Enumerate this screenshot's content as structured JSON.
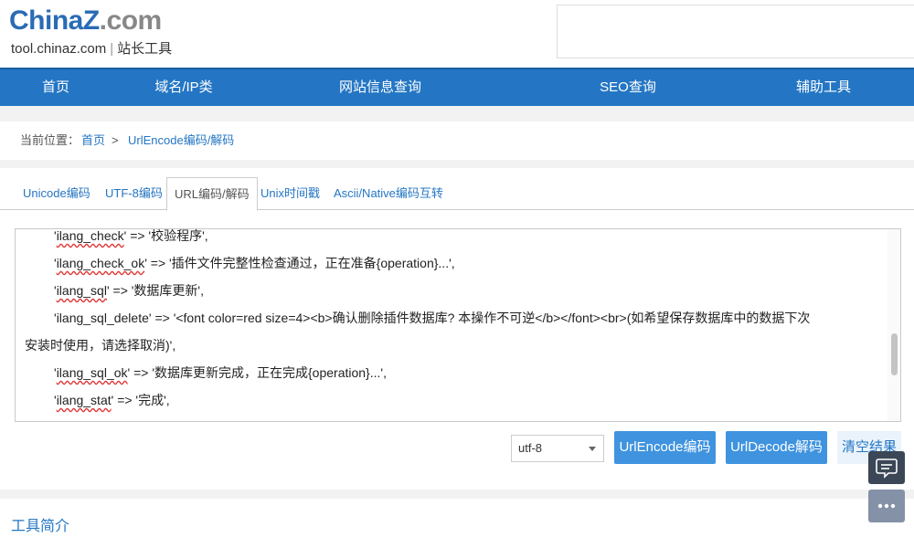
{
  "logo": {
    "brand_a": "China",
    "brand_z": "Z",
    "brand_b": ".com",
    "site": "tool.chinaz.com",
    "sep": "|",
    "tagline": "站长工具"
  },
  "nav": {
    "items": [
      "首页",
      "域名/IP类",
      "网站信息查询",
      "SEO查询",
      "辅助工具"
    ]
  },
  "breadcrumb": {
    "label": "当前位置：",
    "home": "首页",
    "arrow": ">",
    "current": "UrlEncode编码/解码"
  },
  "tabs": [
    "Unicode编码",
    "UTF-8编码",
    "URL编码/解码",
    "Unix时间戳",
    "Ascii/Native编码互转"
  ],
  "editor": {
    "lines": [
      {
        "key": "ilang_check",
        "rest": "' => '校验程序',"
      },
      {
        "key": "ilang_check_ok",
        "rest": "' => '插件文件完整性检查通过，正在准备{operation}...',"
      },
      {
        "key": "ilang_sql",
        "rest": "' => '数据库更新',"
      },
      {
        "key": "ilang_sql_delete",
        "rest": "' => '<font color=red size=4><b>确认删除插件数据库? 本操作不可逆</b></font><br>(如希望保存数据库中的数据下次"
      },
      {
        "key": "",
        "rest": "安装时使用，请选择取消)',"
      },
      {
        "key": "ilang_sql_ok",
        "rest": "' => '数据库更新完成，正在完成{operation}...',"
      },
      {
        "key": "ilang_stat",
        "rest": "' => '完成',"
      }
    ]
  },
  "controls": {
    "charset": "utf-8",
    "encode_label": "UrlEncode编码",
    "decode_label": "UrlDecode解码",
    "clear_label": "清空结果"
  },
  "intro": {
    "title": "工具简介"
  },
  "colors": {
    "nav": "#2476c4",
    "link": "#2476c4",
    "button": "#3f93df"
  },
  "icons": [
    "chat-icon",
    "more-icon"
  ]
}
